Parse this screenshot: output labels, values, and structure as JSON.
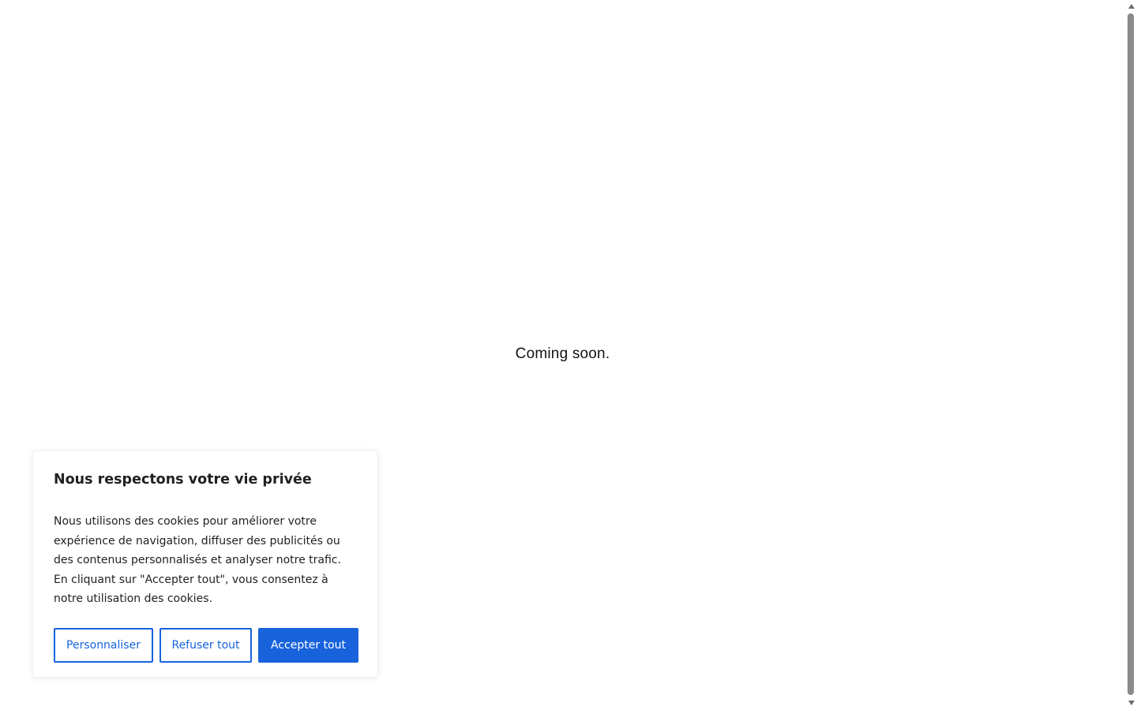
{
  "page": {
    "message": "Coming soon."
  },
  "cookie_banner": {
    "title": "Nous respectons votre vie privée",
    "description": "Nous utilisons des cookies pour améliorer votre expérience de navigation, diffuser des publicités ou des contenus personnalisés et analyser notre trafic. En cliquant sur \"Accepter tout\", vous consentez à notre utilisation des cookies.",
    "customize_label": "Personnaliser",
    "reject_label": "Refuser tout",
    "accept_label": "Accepter tout",
    "accent_color": "#1863dc"
  },
  "scrollbar": {
    "up_icon": "triangle-up",
    "down_icon": "triangle-down"
  }
}
